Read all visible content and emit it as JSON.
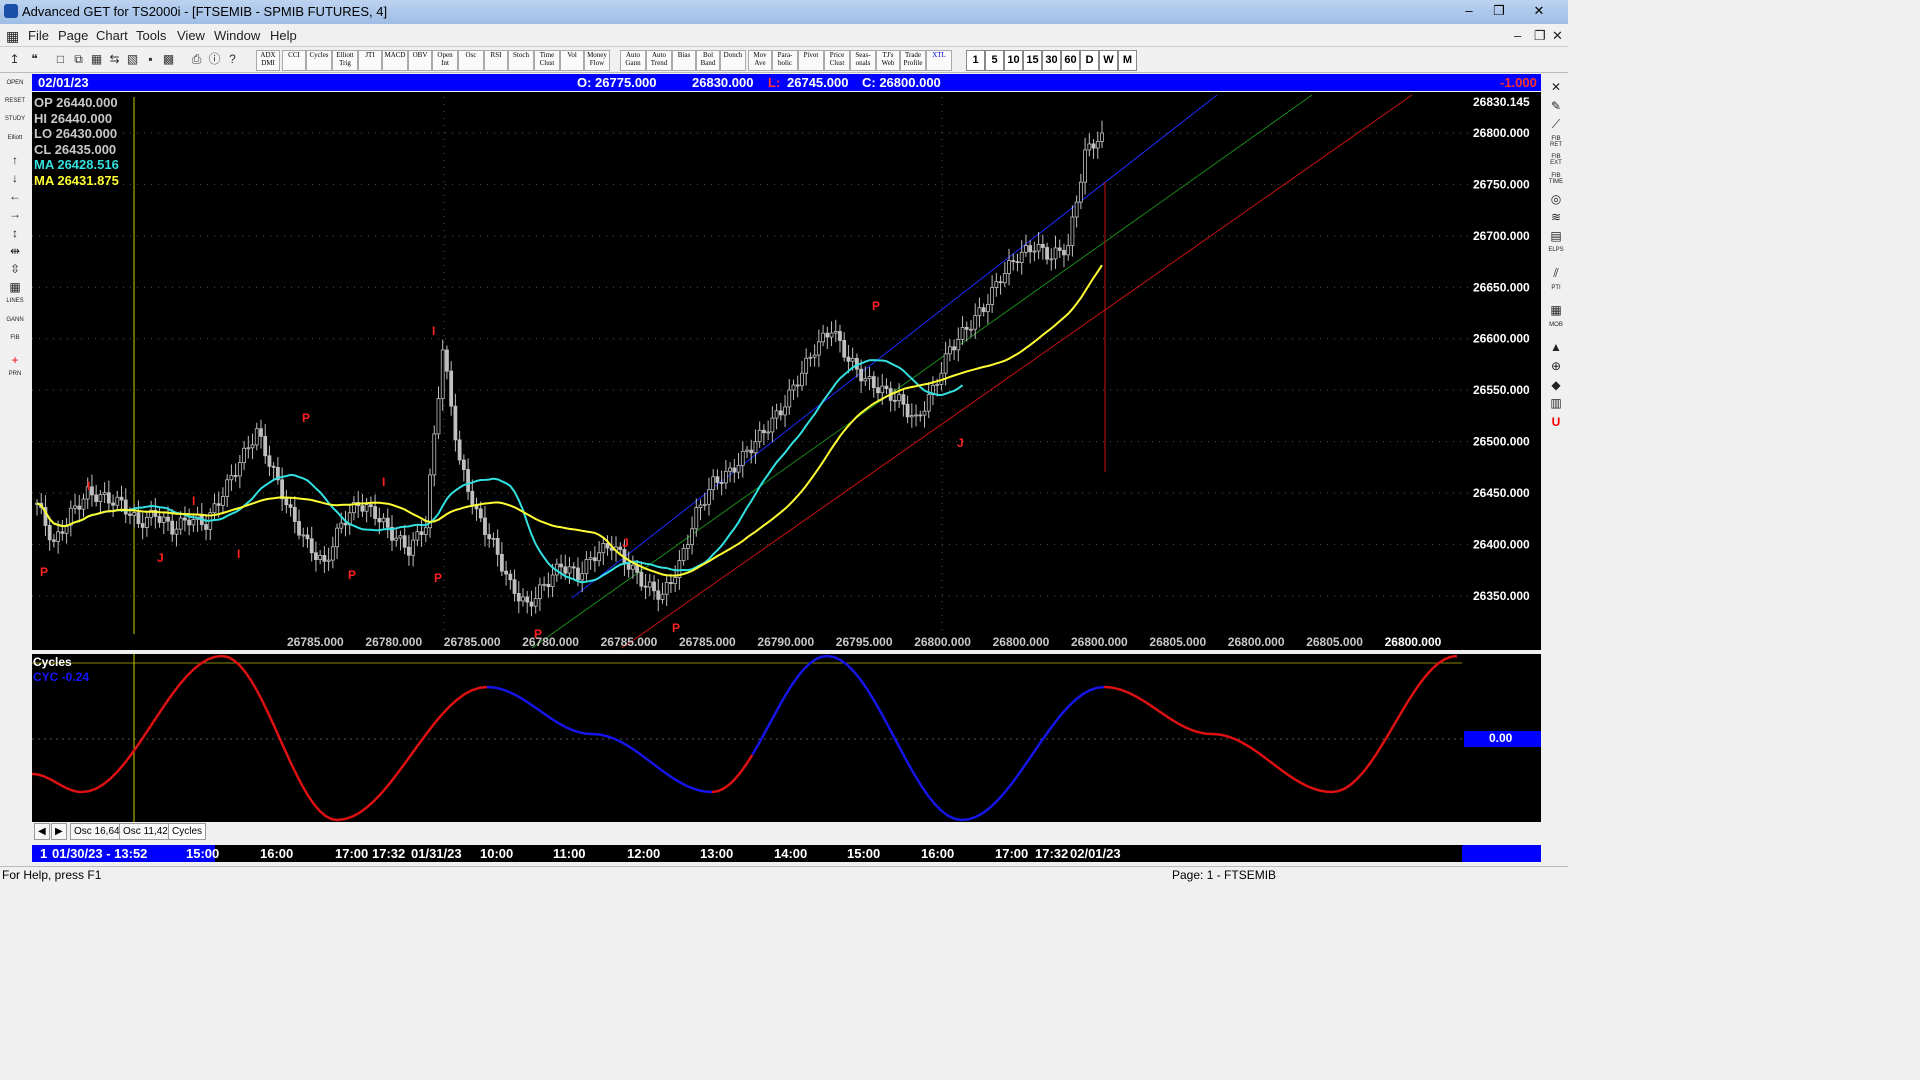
{
  "window": {
    "title": "Advanced GET for TS2000i - [FTSEMIB - SPMIB FUTURES, 4]"
  },
  "menu": [
    "File",
    "Page",
    "Chart",
    "Tools",
    "View",
    "Window",
    "Help"
  ],
  "toolbar_studies": [
    "ADX DMI",
    "CCI",
    "Cycles",
    "Elliott Trig",
    "JTI",
    "MACD",
    "OBV",
    "Open Int",
    "Osc",
    "RSI",
    "Stoch",
    "Time Clust",
    "Vol",
    "Money Flow",
    "Auto Gann",
    "Auto Trend",
    "Bias",
    "Bol Band",
    "Donch",
    "Mov Ave",
    "Para- bolic",
    "Pivot",
    "Price Clust",
    "Seas- onals",
    "TJ's Web",
    "Trade Profile",
    "XTL"
  ],
  "timeframes": [
    "1",
    "5",
    "10",
    "15",
    "30",
    "60",
    "D",
    "W",
    "M"
  ],
  "left_tools": [
    "OPEN",
    "RESET",
    "STUDY",
    "Elliott",
    "↑",
    "↓",
    "←",
    "→",
    "↕",
    "⇹",
    "⇳",
    "▦",
    "LINES",
    "GANN",
    "FIB",
    "+",
    "PRN"
  ],
  "right_tools": [
    "✕",
    "✎",
    "⟋",
    "FIB RET",
    "FIB EXT",
    "FIB TIME",
    "◎",
    "≋",
    "▤",
    "ELPS",
    "⫽",
    "PTI",
    "▦",
    "MOB",
    "▲",
    "⊕",
    "◆",
    "▥",
    "U"
  ],
  "infobar": {
    "date": "02/01/23",
    "open": "O: 26775.000",
    "high": "26830.000",
    "low_label": "L:",
    "low": "26745.000",
    "close": "C: 26800.000",
    "change": "-1.000"
  },
  "legend": {
    "op": "OP  26440.000",
    "hi": "HI   26440.000",
    "lo": "LO  26430.000",
    "cl": "CL  26435.000",
    "ma1": "MA  26428.516",
    "ma2": "MA  26431.875"
  },
  "colors": {
    "background": "#000000",
    "candle": "#c0c0c0",
    "ma_cyan": "#33e0e0",
    "ma_yellow": "#ffff33",
    "channel_blue": "#1a2cff",
    "channel_green": "#1a8a1a",
    "channel_red": "#cc1111",
    "pivot": "#ff2020",
    "cycle_red": "#dd1111",
    "cycle_blue": "#1515e8",
    "info_bg": "#0000ff"
  },
  "price_axis": {
    "labels": [
      "26830.145",
      "26800.000",
      "26750.000",
      "26700.000",
      "26650.000",
      "26600.000",
      "26550.000",
      "26500.000",
      "26450.000",
      "26400.000",
      "26350.000"
    ]
  },
  "bottom_price_labels": [
    "26785.000",
    "26780.000",
    "26785.000",
    "26780.000",
    "26785.000",
    "26785.000",
    "26790.000",
    "26795.000",
    "26800.000",
    "26800.000",
    "26800.000",
    "26805.000",
    "26800.000",
    "26805.000",
    "26800.000"
  ],
  "pivot_labels": [
    "P",
    "I",
    "J",
    "I",
    "P",
    "I",
    "P",
    "I",
    "P",
    "I",
    "P",
    "J",
    "P",
    "J",
    "P"
  ],
  "osc": {
    "title": "Cycles",
    "label": "CYC -0.24",
    "zero_label": "0.00"
  },
  "tabs": [
    "Osc 16,64",
    "Osc 11,42",
    "Cycles"
  ],
  "time_axis": [
    "1",
    "01/30/23 - 13:52",
    "15:00",
    "16:00",
    "17:00",
    "17:32",
    "01/31/23",
    "10:00",
    "11:00",
    "12:00",
    "13:00",
    "14:00",
    "15:00",
    "16:00",
    "17:00",
    "17:32",
    "02/01/23"
  ],
  "status": {
    "help": "For Help, press F1",
    "page": "Page: 1 - FTSEMIB"
  },
  "chart_data": {
    "type": "candlestick",
    "title": "FTSEMIB - SPMIB FUTURES, 4",
    "ylim": [
      26310,
      26835
    ],
    "close_series": [
      26440,
      26400,
      26430,
      26450,
      26445,
      26440,
      26420,
      26430,
      26415,
      26425,
      26420,
      26450,
      26480,
      26510,
      26470,
      26430,
      26400,
      26380,
      26420,
      26440,
      26430,
      26410,
      26395,
      26420,
      26590,
      26480,
      26430,
      26400,
      26360,
      26340,
      26360,
      26380,
      26370,
      26390,
      26400,
      26380,
      26360,
      26350,
      26380,
      26430,
      26460,
      26470,
      26490,
      26510,
      26530,
      26560,
      26590,
      26610,
      26580,
      26560,
      26550,
      26540,
      26520,
      26550,
      26590,
      26610,
      26630,
      26660,
      26680,
      26690,
      26680,
      26690,
      26780,
      26800
    ],
    "series": [
      {
        "name": "MA",
        "value": 26428.516
      },
      {
        "name": "MA",
        "value": 26431.875
      }
    ],
    "oscillator": {
      "name": "CYC",
      "last": -0.24,
      "zero": 0.0
    }
  }
}
